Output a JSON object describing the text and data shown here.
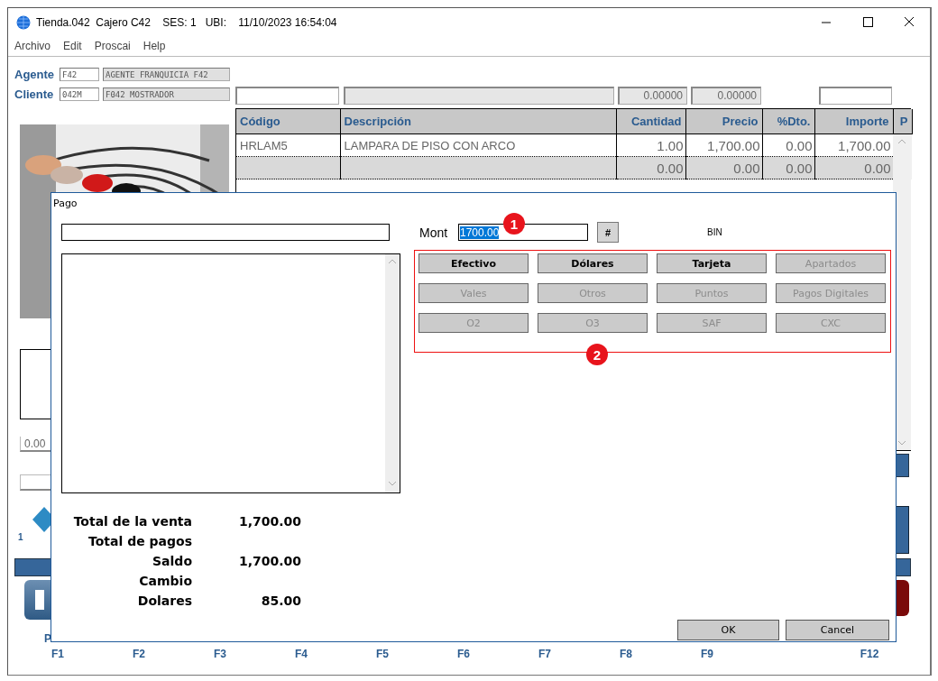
{
  "window": {
    "title": "Tienda.042  Cajero C42    SES: 1   UBI:    11/10/2023 16:54:04"
  },
  "menu": [
    "Archivo",
    "Edit",
    "Proscai",
    "Help"
  ],
  "agent": {
    "label": "Agente",
    "code": "F42",
    "name": "AGENTE FRANQUICIA F42"
  },
  "client": {
    "label": "Cliente",
    "code": "042M",
    "name": "F042 MOSTRADOR"
  },
  "item_fields": {
    "value_1": "0.00000",
    "value_2": "0.00000"
  },
  "table": {
    "columns": [
      "Código",
      "Descripción",
      "Cantidad",
      "Precio",
      "%Dto.",
      "Importe",
      "P"
    ],
    "rows": [
      {
        "code": "HRLAM5",
        "description": "LAMPARA DE PISO CON ARCO",
        "quantity": "1.00",
        "price": "1,700.00",
        "discount": "0.00",
        "amount": "1,700.00"
      },
      {
        "quantity": "0.00",
        "price": "0.00",
        "discount": "0.00",
        "amount": "0.00"
      }
    ]
  },
  "left_panel": {
    "discount_value": "0.00",
    "counter": "1",
    "label_2": "P"
  },
  "function_keys": [
    "F1",
    "F2",
    "F3",
    "F4",
    "F5",
    "F6",
    "F7",
    "F8",
    "F9",
    "F12"
  ],
  "dialog": {
    "title": "Pago",
    "amount_label": "Mont",
    "amount_value": "1700.00",
    "amount_text_selected": true,
    "hash_button": "#",
    "bin_label": "BIN",
    "payment_buttons": [
      {
        "label": "Efectivo",
        "disabled": false
      },
      {
        "label": "Dólares",
        "disabled": false
      },
      {
        "label": "Tarjeta",
        "disabled": false
      },
      {
        "label": "Apartados",
        "disabled": true
      },
      {
        "label": "Vales",
        "disabled": true
      },
      {
        "label": "Otros",
        "disabled": true
      },
      {
        "label": "Puntos",
        "disabled": true
      },
      {
        "label": "Pagos Digitales",
        "disabled": true
      },
      {
        "label": "O2",
        "disabled": true
      },
      {
        "label": "O3",
        "disabled": true
      },
      {
        "label": "SAF",
        "disabled": true
      },
      {
        "label": "CXC",
        "disabled": true
      }
    ],
    "totals": [
      {
        "label": "Total de la venta",
        "value": "1,700.00"
      },
      {
        "label": "Total de pagos"
      },
      {
        "label": "Saldo",
        "value": "1,700.00"
      },
      {
        "label": "Cambio"
      },
      {
        "label": "Dolares",
        "value": "85.00"
      }
    ],
    "buttons": [
      "OK",
      "Cancel"
    ]
  },
  "annotations": [
    "1",
    "2"
  ]
}
